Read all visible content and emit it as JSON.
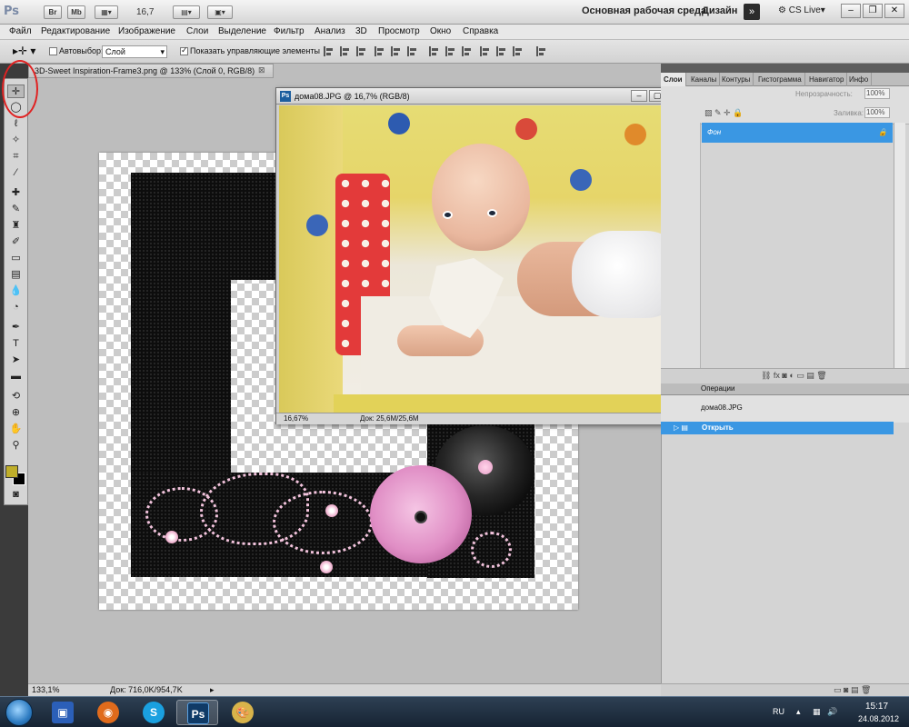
{
  "app": {
    "logo": "Ps",
    "bridge_button": "Br",
    "mini_bridge_button": "Mb",
    "zoom_value": "16,7",
    "workspace_label": "Основная рабочая среда",
    "design_label": "Дизайн",
    "more_label": "»",
    "cs_live_label": "CS Live"
  },
  "menu": [
    "Файл",
    "Редактирование",
    "Изображение",
    "Слои",
    "Выделение",
    "Фильтр",
    "Анализ",
    "3D",
    "Просмотр",
    "Окно",
    "Справка"
  ],
  "options": {
    "auto_select_label": "Автовыбор:",
    "auto_select_value": "Слой",
    "show_controls_label": "Показать управляющие элементы"
  },
  "document": {
    "tab_title": "3D-Sweet Inspiration-Frame3.png @ 133% (Слой 0, RGB/8)",
    "zoom": "133,1%",
    "doc_size": "Док: 716,0K/954,7K"
  },
  "photo_window": {
    "title": "дома08.JPG @ 16,7% (RGB/8)",
    "zoom": "16,67%",
    "doc_size": "Док: 25,6M/25,6M"
  },
  "layers_panel": {
    "tabs": [
      "Слои",
      "Каналы",
      "Контуры",
      "Гистограмма",
      "Навигатор",
      "Инфо"
    ],
    "opacity_label": "Непрозрачность:",
    "opacity_value": "100%",
    "fill_label": "Заливка:",
    "fill_value": "100%",
    "layer_name": "Фон"
  },
  "actions_panel": {
    "tab": "Операции",
    "history_item": "дома08.JPG",
    "open_item": "Открыть"
  },
  "taskbar": {
    "language": "RU",
    "time": "15:17",
    "date": "24.08.2012"
  },
  "colors": {
    "foreground": "#bfae2a",
    "background": "#000000",
    "selection": "#3a97e3",
    "annotation_circle": "#e02222"
  },
  "icons": [
    "move-tool-icon",
    "marquee-icon",
    "lasso-icon",
    "magic-wand-icon",
    "crop-icon",
    "eyedropper-icon",
    "healing-icon",
    "brush-icon",
    "stamp-icon",
    "history-brush-icon",
    "eraser-icon",
    "gradient-icon",
    "blur-icon",
    "dodge-icon",
    "pen-icon",
    "type-icon",
    "path-select-icon",
    "shape-icon",
    "3d-rotate-icon",
    "3d-camera-icon",
    "hand-icon",
    "zoom-icon",
    "quick-mask-icon"
  ]
}
